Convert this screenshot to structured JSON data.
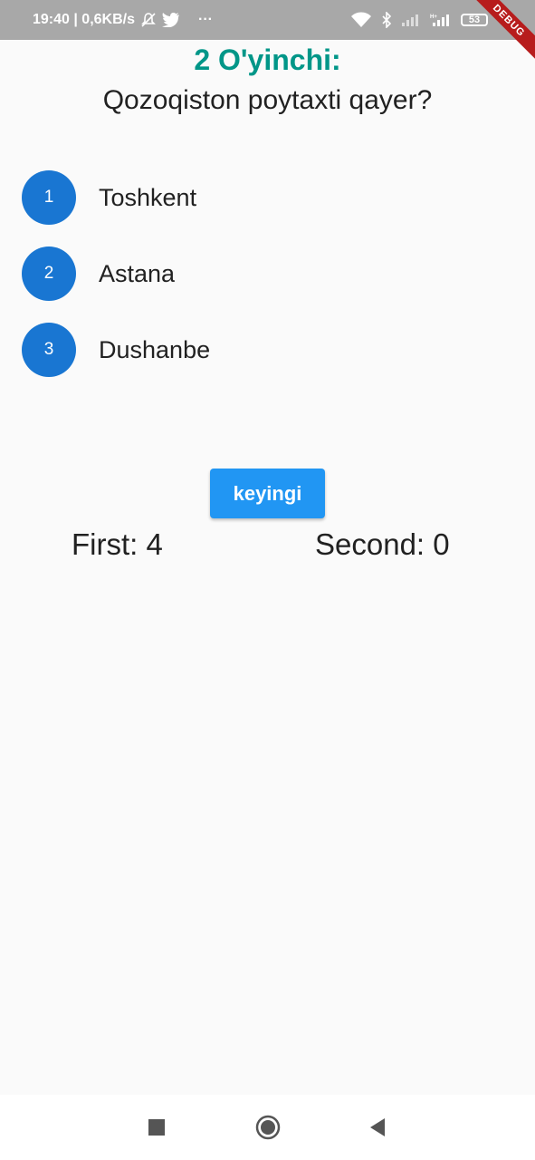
{
  "status_bar": {
    "time_speed": "19:40 | 0,6KB/s",
    "more": "···",
    "battery": "53"
  },
  "debug_banner": "DEBUG",
  "header": {
    "player_title": "2 O'yinchi:",
    "question": "Qozoqiston poytaxti qayer?"
  },
  "answers": [
    {
      "number": "1",
      "text": "Toshkent"
    },
    {
      "number": "2",
      "text": "Astana"
    },
    {
      "number": "3",
      "text": "Dushanbe"
    }
  ],
  "next_button": "keyingi",
  "scores": {
    "first": "First: 4",
    "second": "Second: 0"
  },
  "colors": {
    "title": "#009688",
    "answer_circle": "#1976d2",
    "button": "#2196f3",
    "status_bar": "#a8a8a8"
  },
  "icons": {
    "status": [
      "do-not-disturb-icon",
      "twitter-icon",
      "wifi-icon",
      "bluetooth-icon",
      "signal-icon",
      "battery-icon"
    ],
    "nav": [
      "recent-apps-icon",
      "home-icon",
      "back-icon"
    ]
  }
}
